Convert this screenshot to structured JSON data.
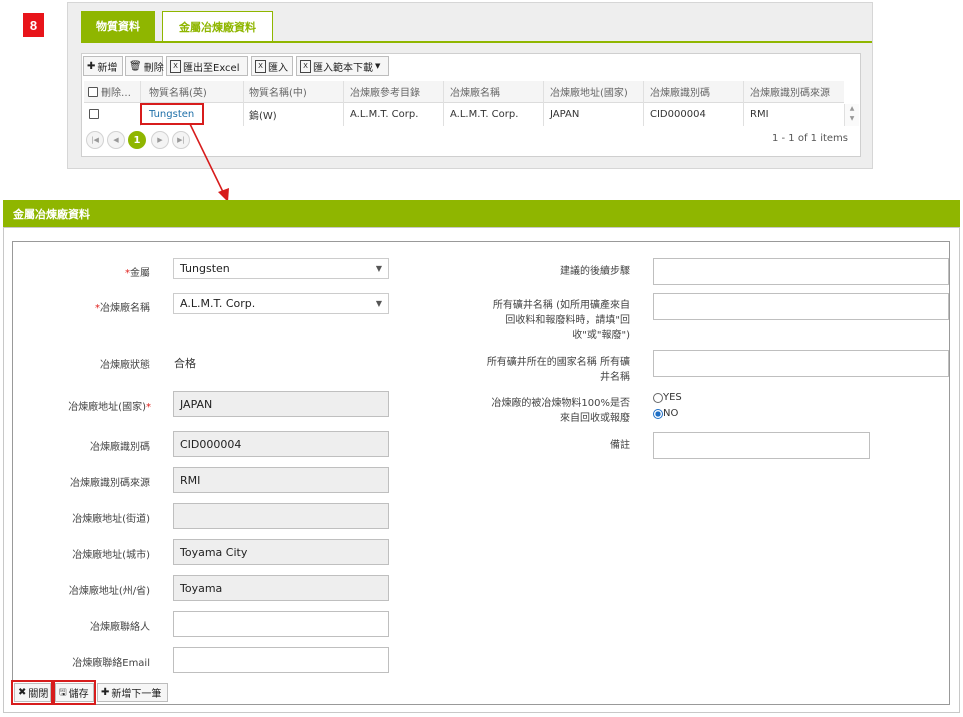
{
  "step_number": "8",
  "tabs": [
    "物質資料",
    "金屬冶煉廠資料"
  ],
  "toolbar": {
    "add": "新增",
    "delete": "刪除",
    "export": "匯出至Excel",
    "import": "匯入",
    "import_template": "匯入範本下載"
  },
  "grid": {
    "headers": [
      "刪除…",
      "物質名稱(英)",
      "物質名稱(中)",
      "冶煉廠參考目錄",
      "冶煉廠名稱",
      "冶煉廠地址(國家)",
      "冶煉廠識別碼",
      "冶煉廠識別碼來源"
    ],
    "rows": [
      [
        "",
        "Tungsten",
        "鎢(W)",
        "A.L.M.T. Corp.",
        "A.L.M.T. Corp.",
        "JAPAN",
        "CID000004",
        "RMI"
      ]
    ],
    "current_page": "1",
    "page_info": "1 - 1 of 1 items"
  },
  "dialog": {
    "title": "金屬冶煉廠資料",
    "left_fields": {
      "metal_label": "金屬",
      "metal_value": "Tungsten",
      "smelter_name_label": "冶煉廠名稱",
      "smelter_name_value": "A.L.M.T. Corp.",
      "status_label": "冶煉廠狀態",
      "status_value": "合格",
      "country_label": "冶煉廠地址(國家)",
      "country_value": "JAPAN",
      "id_label": "冶煉廠識別碼",
      "id_value": "CID000004",
      "id_source_label": "冶煉廠識別碼來源",
      "id_source_value": "RMI",
      "street_label": "冶煉廠地址(街道)",
      "street_value": "",
      "city_label": "冶煉廠地址(城市)",
      "city_value": "Toyama City",
      "state_label": "冶煉廠地址(州/省)",
      "state_value": "Toyama",
      "contact_label": "冶煉廠聯絡人",
      "contact_value": "",
      "email_label": "冶煉廠聯絡Email",
      "email_value": ""
    },
    "right_fields": {
      "next_steps_label": "建議的後續步驟",
      "mine_name_label": "所有礦井名稱 (如所用礦產來自回收料和報廢料時，請填\"回收\"或\"報廢\")",
      "mine_country_label": "所有礦井所在的國家名稱 所有礦井名稱",
      "recycled_label": "冶煉廠的被冶煉物料100%是否來自回收或報廢",
      "radio_yes": "YES",
      "radio_no": "NO",
      "radio_selected": "NO",
      "remark_label": "備註"
    },
    "buttons": {
      "close": "關閉",
      "save": "儲存",
      "add_next": "新增下一筆"
    }
  },
  "colors": {
    "accent": "#8fb600",
    "highlight": "#d71c1c",
    "link": "#1d6fa8"
  }
}
